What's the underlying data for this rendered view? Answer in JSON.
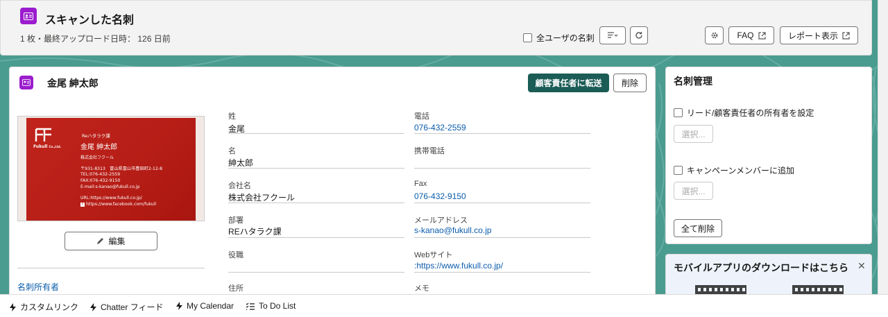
{
  "header": {
    "title": "スキャンした名刺",
    "subtitle": "1 枚・最終アップロード日時： 126 日前",
    "all_users_label": "全ユーザの名刺",
    "faq_label": "FAQ",
    "report_label": "レポート表示"
  },
  "record": {
    "name": "金尾 紳太郎",
    "forward_label": "顧客責任者に転送",
    "delete_label": "削除",
    "edit_label": "編集",
    "owner_label": "名刺所有者",
    "fields_left": [
      {
        "label": "姓",
        "value": "金尾"
      },
      {
        "label": "名",
        "value": "紳太郎"
      },
      {
        "label": "会社名",
        "value": "株式会社フクール"
      },
      {
        "label": "部署",
        "value": "REハタラク課"
      },
      {
        "label": "役職",
        "value": ""
      },
      {
        "label": "住所",
        "value": ""
      }
    ],
    "fields_right": [
      {
        "label": "電話",
        "value": "076-432-2559"
      },
      {
        "label": "携帯電話",
        "value": ""
      },
      {
        "label": "Fax",
        "value": "076-432-9150"
      },
      {
        "label": "メールアドレス",
        "value": "s-kanao@fukull.co.jp"
      },
      {
        "label": "Webサイト",
        "value": ":https://www.fukull.co.jp/"
      },
      {
        "label": "メモ",
        "value": ""
      }
    ]
  },
  "business_card": {
    "logo_text": "Fukull",
    "logo_suffix": "Co.,Ltd.",
    "department": "Reハタラク課",
    "name": "金尾 紳太郎",
    "company": "株式会社フクール",
    "address": "〒931-8313　富山県富山市豊田町2-12-8",
    "tel": "TEL:076-432-2559",
    "fax": "FAX:076-432-9150",
    "email": "E-mail:s-kanao@fukull.co.jp",
    "url": "URL:https://www.fukull.co.jp/",
    "facebook": "https://www.facebook.com/fukull"
  },
  "sidebar": {
    "title": "名刺管理",
    "owner_check_label": "リード/顧客責任者の所有者を設定",
    "select_label_1": "選択...",
    "campaign_check_label": "キャンペーンメンバーに追加",
    "select_label_2": "選択...",
    "delete_all_label": "全て削除"
  },
  "mobile": {
    "title": "モバイルアプリのダウンロードはこちら"
  },
  "utility_bar": {
    "items": [
      "カスタムリンク",
      "Chatter フィード",
      "My Calendar",
      "To Do List"
    ]
  },
  "colors": {
    "brand": "#1b5c56",
    "object_icon": "#9b1cce",
    "link": "#0b5cab",
    "background": "#4a9b90"
  }
}
